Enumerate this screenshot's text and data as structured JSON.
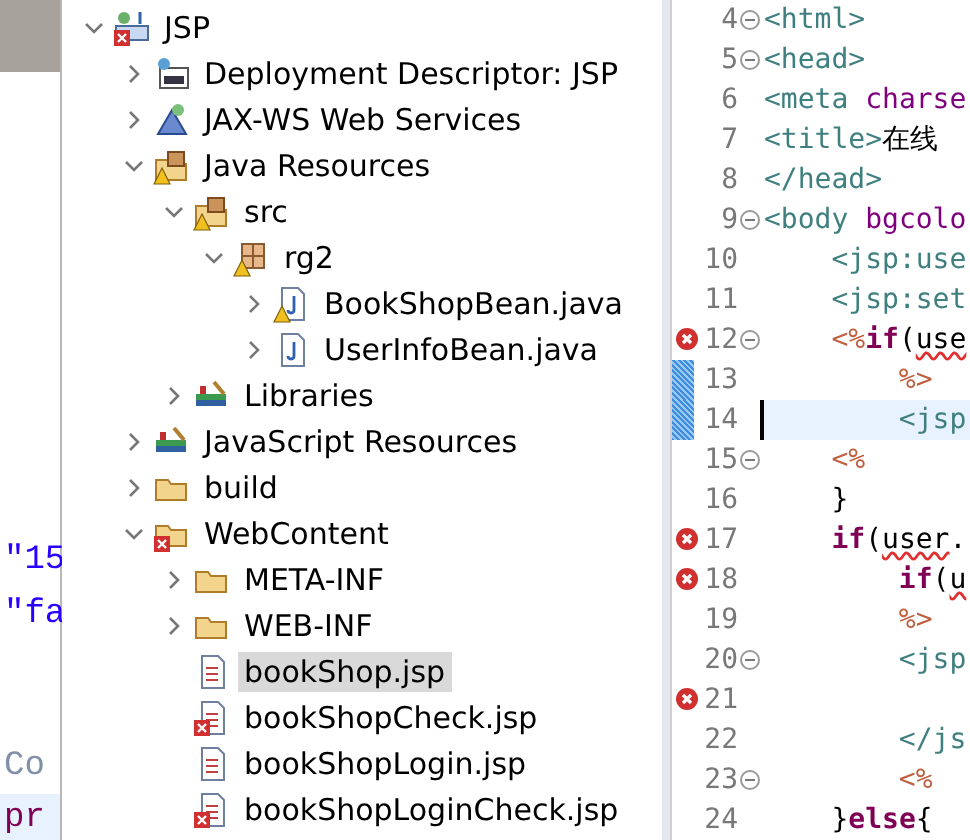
{
  "background_editor": {
    "lines": [
      {
        "text": "\"15",
        "kind": "string"
      },
      {
        "text": "\"fa",
        "kind": "string"
      },
      {
        "text": "Co",
        "kind": "plain"
      },
      {
        "text": "pr",
        "kind": "keyword"
      }
    ]
  },
  "project_tree": [
    {
      "label": "JSP",
      "kind": "project",
      "expanded": true,
      "selected": false,
      "error": true,
      "warning": false,
      "children": [
        {
          "label": "Deployment Descriptor: JSP",
          "kind": "descriptor",
          "expanded": false,
          "selected": false,
          "error": false,
          "warning": false
        },
        {
          "label": "JAX-WS Web Services",
          "kind": "services",
          "expanded": false,
          "selected": false,
          "error": false,
          "warning": false
        },
        {
          "label": "Java Resources",
          "kind": "resources",
          "expanded": true,
          "selected": false,
          "error": false,
          "warning": true,
          "children": [
            {
              "label": "src",
              "kind": "source",
              "expanded": true,
              "selected": false,
              "error": false,
              "warning": true,
              "children": [
                {
                  "label": "rg2",
                  "kind": "package",
                  "expanded": true,
                  "selected": false,
                  "error": false,
                  "warning": true,
                  "children": [
                    {
                      "label": "BookShopBean.java",
                      "kind": "java",
                      "expanded": false,
                      "selected": false,
                      "error": false,
                      "warning": true
                    },
                    {
                      "label": "UserInfoBean.java",
                      "kind": "java",
                      "expanded": false,
                      "selected": false,
                      "error": false,
                      "warning": false
                    }
                  ]
                }
              ]
            },
            {
              "label": "Libraries",
              "kind": "library",
              "expanded": false,
              "selected": false,
              "error": false,
              "warning": false
            }
          ]
        },
        {
          "label": "JavaScript Resources",
          "kind": "library",
          "expanded": false,
          "selected": false,
          "error": false,
          "warning": false
        },
        {
          "label": "build",
          "kind": "folder",
          "expanded": false,
          "selected": false,
          "error": false,
          "warning": false
        },
        {
          "label": "WebContent",
          "kind": "folder",
          "expanded": true,
          "selected": false,
          "error": true,
          "warning": false,
          "children": [
            {
              "label": "META-INF",
              "kind": "folder",
              "expanded": false,
              "selected": false,
              "error": false,
              "warning": false
            },
            {
              "label": "WEB-INF",
              "kind": "folder",
              "expanded": false,
              "selected": false,
              "error": false,
              "warning": false
            },
            {
              "label": "bookShop.jsp",
              "kind": "jsp",
              "selected": true,
              "error": false,
              "warning": false
            },
            {
              "label": "bookShopCheck.jsp",
              "kind": "jsp",
              "selected": false,
              "error": true,
              "warning": false
            },
            {
              "label": "bookShopLogin.jsp",
              "kind": "jsp",
              "selected": false,
              "error": false,
              "warning": false
            },
            {
              "label": "bookShopLoginCheck.jsp",
              "kind": "jsp",
              "selected": false,
              "error": true,
              "warning": false
            }
          ]
        }
      ]
    }
  ],
  "code_editor": {
    "lines": [
      {
        "number": "4",
        "fold": true,
        "error": false,
        "changed": false,
        "current": false,
        "segments": [
          {
            "kind": "tag",
            "text": "<html>"
          }
        ]
      },
      {
        "number": "5",
        "fold": true,
        "error": false,
        "changed": false,
        "current": false,
        "segments": [
          {
            "kind": "tag",
            "text": "<head>"
          }
        ]
      },
      {
        "number": "6",
        "fold": false,
        "error": false,
        "changed": false,
        "current": false,
        "segments": [
          {
            "kind": "tag",
            "text": "<meta"
          },
          {
            "kind": "attr",
            "text": " charse"
          }
        ]
      },
      {
        "number": "7",
        "fold": false,
        "error": false,
        "changed": false,
        "current": false,
        "segments": [
          {
            "kind": "tag",
            "text": "<title>"
          },
          {
            "kind": "plain",
            "text": "在线"
          }
        ]
      },
      {
        "number": "8",
        "fold": false,
        "error": false,
        "changed": false,
        "current": false,
        "segments": [
          {
            "kind": "tag",
            "text": "</head>"
          }
        ]
      },
      {
        "number": "9",
        "fold": true,
        "error": false,
        "changed": false,
        "current": false,
        "segments": [
          {
            "kind": "tag",
            "text": "<body"
          },
          {
            "kind": "attr",
            "text": " bgcolo"
          }
        ]
      },
      {
        "number": "10",
        "fold": false,
        "error": false,
        "changed": false,
        "current": false,
        "segments": [
          {
            "kind": "tag",
            "text": "    <jsp:use"
          }
        ]
      },
      {
        "number": "11",
        "fold": false,
        "error": false,
        "changed": false,
        "current": false,
        "segments": [
          {
            "kind": "tag",
            "text": "    <jsp:set"
          }
        ]
      },
      {
        "number": "12",
        "fold": true,
        "error": true,
        "changed": false,
        "current": false,
        "segments": [
          {
            "kind": "delim",
            "text": "    <%"
          },
          {
            "kind": "keyword",
            "text": "if"
          },
          {
            "kind": "plain",
            "text": "("
          },
          {
            "kind": "squiggle",
            "text": "use"
          }
        ]
      },
      {
        "number": "13",
        "fold": false,
        "error": false,
        "changed": true,
        "current": false,
        "segments": [
          {
            "kind": "delim",
            "text": "        %>"
          }
        ]
      },
      {
        "number": "14",
        "fold": false,
        "error": false,
        "changed": true,
        "current": true,
        "segments": [
          {
            "kind": "tag",
            "text": "        <jsp"
          }
        ]
      },
      {
        "number": "15",
        "fold": true,
        "error": false,
        "changed": false,
        "current": false,
        "segments": [
          {
            "kind": "delim",
            "text": "    <%"
          }
        ]
      },
      {
        "number": "16",
        "fold": false,
        "error": false,
        "changed": false,
        "current": false,
        "segments": [
          {
            "kind": "plain",
            "text": "    }"
          }
        ]
      },
      {
        "number": "17",
        "fold": false,
        "error": true,
        "changed": false,
        "current": false,
        "segments": [
          {
            "kind": "keyword",
            "text": "    if"
          },
          {
            "kind": "plain",
            "text": "("
          },
          {
            "kind": "squiggle",
            "text": "user"
          },
          {
            "kind": "plain",
            "text": "."
          }
        ]
      },
      {
        "number": "18",
        "fold": false,
        "error": true,
        "changed": false,
        "current": false,
        "segments": [
          {
            "kind": "keyword",
            "text": "        if"
          },
          {
            "kind": "plain",
            "text": "("
          },
          {
            "kind": "squiggle",
            "text": "u"
          }
        ]
      },
      {
        "number": "19",
        "fold": false,
        "error": false,
        "changed": false,
        "current": false,
        "segments": [
          {
            "kind": "delim",
            "text": "        %>"
          }
        ]
      },
      {
        "number": "20",
        "fold": true,
        "error": false,
        "changed": false,
        "current": false,
        "segments": [
          {
            "kind": "tag",
            "text": "        <jsp"
          }
        ]
      },
      {
        "number": "21",
        "fold": false,
        "error": true,
        "changed": false,
        "current": false
      },
      {
        "number": "22",
        "fold": false,
        "error": false,
        "changed": false,
        "current": false,
        "segments": [
          {
            "kind": "tag",
            "text": "        </js"
          }
        ]
      },
      {
        "number": "23",
        "fold": true,
        "error": false,
        "changed": false,
        "current": false,
        "segments": [
          {
            "kind": "delim",
            "text": "        <%"
          }
        ]
      },
      {
        "number": "24",
        "fold": false,
        "error": false,
        "changed": false,
        "current": false,
        "segments": [
          {
            "kind": "plain",
            "text": "    }"
          },
          {
            "kind": "keyword",
            "text": "else"
          },
          {
            "kind": "plain",
            "text": "{"
          }
        ]
      }
    ]
  }
}
